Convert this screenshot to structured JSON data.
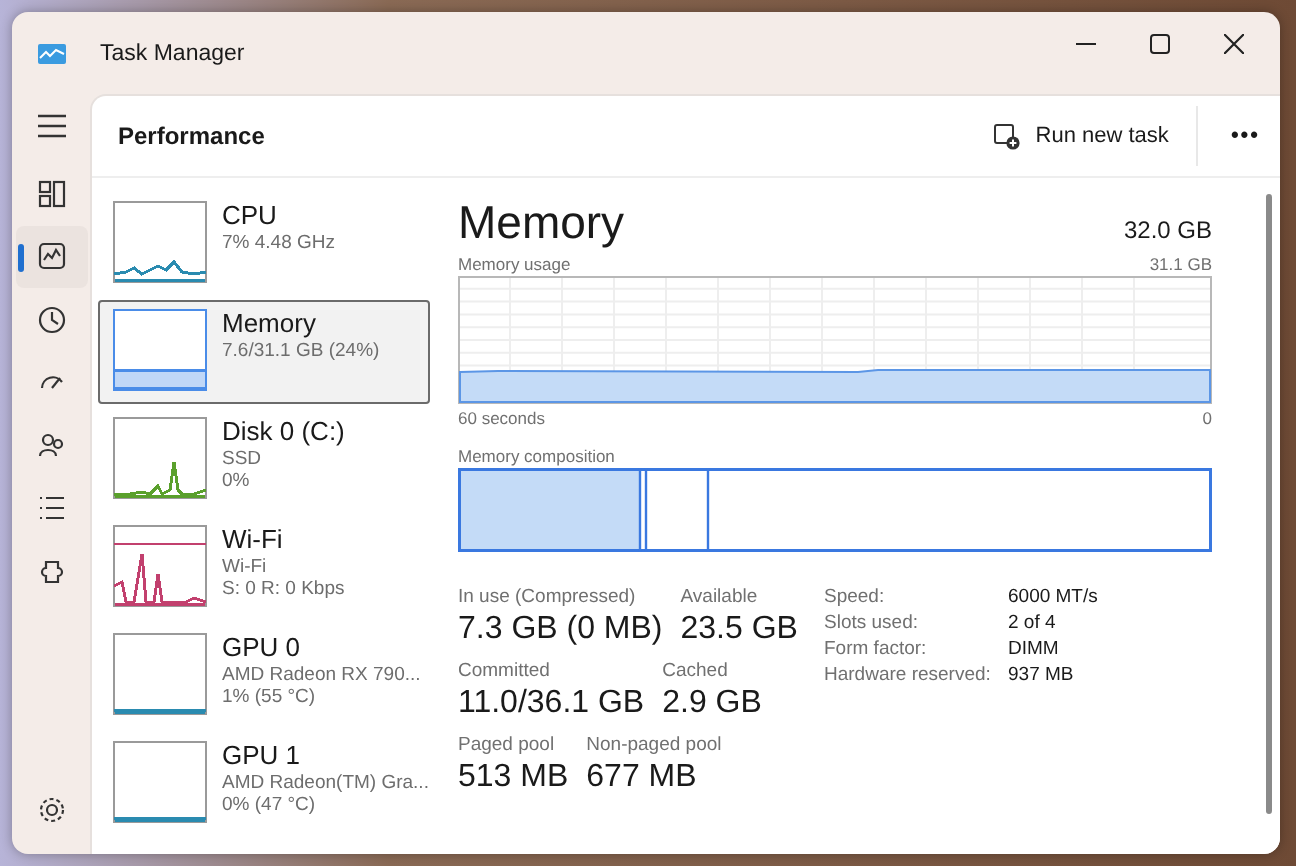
{
  "window": {
    "title": "Task Manager"
  },
  "nav": [
    {
      "selected": false
    },
    {
      "selected": true
    },
    {
      "selected": false
    },
    {
      "selected": false
    },
    {
      "selected": false
    },
    {
      "selected": false
    },
    {
      "selected": false
    },
    {
      "selected": false
    }
  ],
  "header": {
    "title": "Performance",
    "run_new_task": "Run new task",
    "more": "•••"
  },
  "devices": [
    {
      "name": "CPU",
      "lines": [
        "7%  4.48 GHz"
      ],
      "selected": false,
      "color": "#2a8bb0"
    },
    {
      "name": "Memory",
      "lines": [
        "7.6/31.1 GB (24%)"
      ],
      "selected": true,
      "color": "#4a8ce8"
    },
    {
      "name": "Disk 0 (C:)",
      "lines": [
        "SSD",
        "0%"
      ],
      "selected": false,
      "color": "#5aa02c"
    },
    {
      "name": "Wi-Fi",
      "lines": [
        "Wi-Fi",
        "S: 0  R: 0 Kbps"
      ],
      "selected": false,
      "color": "#c2406e"
    },
    {
      "name": "GPU 0",
      "lines": [
        "AMD Radeon RX 790...",
        "1%  (55 °C)"
      ],
      "selected": false,
      "color": "#2a8bb0"
    },
    {
      "name": "GPU 1",
      "lines": [
        "AMD Radeon(TM) Gra...",
        "0%  (47 °C)"
      ],
      "selected": false,
      "color": "#2a8bb0"
    }
  ],
  "detail": {
    "title": "Memory",
    "total": "32.0 GB",
    "usage_label": "Memory usage",
    "usage_max": "31.1 GB",
    "time_span": "60 seconds",
    "time_end": "0",
    "composition_label": "Memory composition",
    "stats": [
      [
        {
          "label": "In use (Compressed)",
          "value": "7.3 GB (0 MB)"
        },
        {
          "label": "Available",
          "value": "23.5 GB"
        }
      ],
      [
        {
          "label": "Committed",
          "value": "11.0/36.1 GB"
        },
        {
          "label": "Cached",
          "value": "2.9 GB"
        }
      ],
      [
        {
          "label": "Paged pool",
          "value": "513 MB"
        },
        {
          "label": "Non-paged pool",
          "value": "677 MB"
        }
      ]
    ],
    "specs": [
      {
        "label": "Speed:",
        "value": "6000 MT/s"
      },
      {
        "label": "Slots used:",
        "value": "2 of 4"
      },
      {
        "label": "Form factor:",
        "value": "DIMM"
      },
      {
        "label": "Hardware reserved:",
        "value": "937 MB"
      }
    ]
  }
}
